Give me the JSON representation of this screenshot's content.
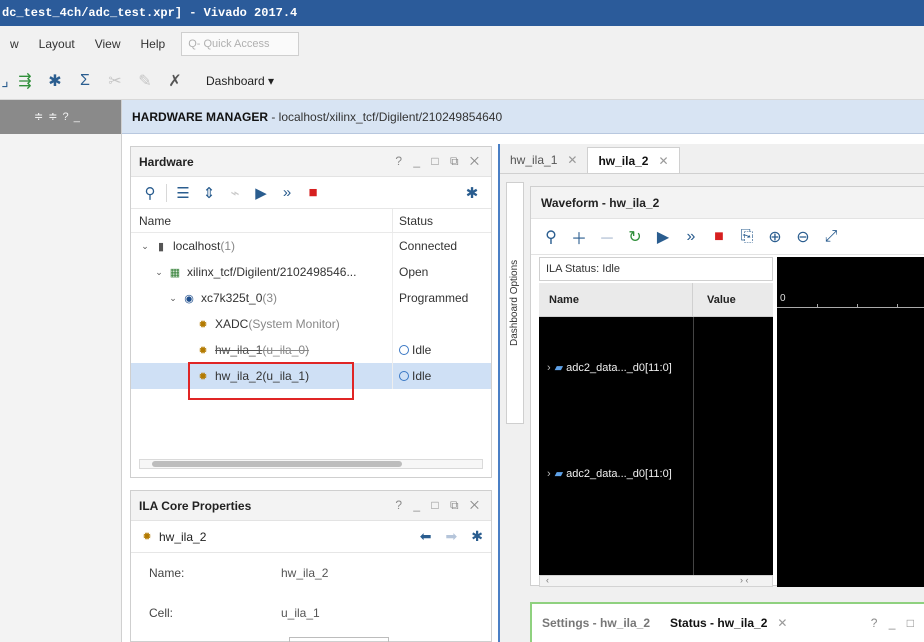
{
  "window": {
    "title": "dc_test_4ch/adc_test.xpr] - Vivado 2017.4"
  },
  "menubar": {
    "items": [
      "w",
      "Layout",
      "View",
      "Help"
    ],
    "quick_access_placeholder": "Q- Quick Access"
  },
  "toolbar": {
    "dashboard_label": "Dashboard ▾"
  },
  "left_strip": {
    "controls": "≑ ≑ ? _"
  },
  "hardware_manager": {
    "title": "HARDWARE MANAGER",
    "path": " - localhost/xilinx_tcf/Digilent/210249854640"
  },
  "hardware_panel": {
    "title": "Hardware",
    "controls": "? _ □ ⧉ ✕",
    "columns": {
      "name": "Name",
      "status": "Status"
    },
    "rows": [
      {
        "label": "localhost",
        "suffix": " (1)",
        "status": "Connected",
        "icon": "server-icon"
      },
      {
        "label": "xilinx_tcf/Digilent/2102498546...",
        "suffix": "",
        "status": "Open",
        "icon": "chip-icon"
      },
      {
        "label": "xc7k325t_0",
        "suffix": " (3)",
        "status": "Programmed",
        "icon": "device-icon"
      },
      {
        "label": "XADC",
        "suffix": " (System Monitor)",
        "status": "",
        "icon": "xadc-icon"
      },
      {
        "label": "hw_ila_1",
        "suffix": " (u_ila_0)",
        "status": "Idle",
        "icon": "ila-core-icon"
      },
      {
        "label": "hw_ila_2",
        "suffix": " (u_ila_1)",
        "status": "Idle",
        "icon": "ila-core-icon"
      }
    ]
  },
  "ila_core_properties": {
    "title": "ILA Core Properties",
    "controls": "? _ □ ⧉ ✕",
    "selected": "hw_ila_2",
    "props": [
      {
        "label": "Name:",
        "value": "hw_ila_2"
      },
      {
        "label": "Cell:",
        "value": "u_ila_1"
      }
    ]
  },
  "right_tabs": {
    "tabs": [
      "hw_ila_1",
      "hw_ila_2"
    ],
    "close": "✕"
  },
  "dashboard_options": {
    "label": "Dashboard Options"
  },
  "waveform": {
    "title": "Waveform - hw_ila_2",
    "ila_status": "ILA Status: Idle",
    "columns": {
      "name": "Name",
      "value": "Value"
    },
    "signals": [
      {
        "name": "adc2_data..._d0[11:0]"
      },
      {
        "name": "adc2_data..._d0[11:0]"
      }
    ],
    "ruler_zero": "0",
    "scroll_left": "‹",
    "scroll_right": "› ‹"
  },
  "bottom_panel": {
    "tabs": [
      "Settings - hw_ila_2",
      "Status - hw_ila_2"
    ],
    "close": "✕",
    "controls": "? _ □"
  },
  "colors": {
    "titlebar": "#2b5b9a",
    "hm_bar": "#d8e4f3",
    "selection": "#cfe0f5",
    "highlight_box": "#e02525",
    "stop_red": "#d61f1f",
    "accent_blue": "#4a7fc5"
  }
}
